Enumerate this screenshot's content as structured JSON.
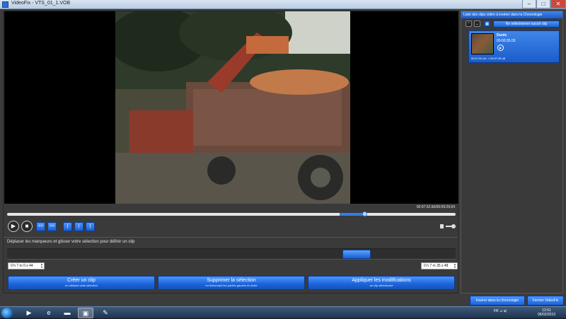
{
  "window": {
    "title": "VideoFix - VTS_01_1.VOB",
    "min": "–",
    "max": "□",
    "close": "✕"
  },
  "player": {
    "timecode": "00:07:32.66/00:09:29.64",
    "play": "▶",
    "stop": "■",
    "rewind": "<<",
    "forward": ">>",
    "mark_in": "[",
    "mark_cut": "|",
    "mark_out": "]",
    "seek_selection_start": 0.742,
    "seek_selection_end": 0.801,
    "seek_position": 0.797
  },
  "selection": {
    "instruction": "Déplacer les marqueurs et glisser votre sélection pour définir un clip",
    "start_time": "0 h  7 m  0 s 44",
    "end_time": "0 h  7 m 35 s 48",
    "spin_arrows": "▲\n▼"
  },
  "actions": [
    {
      "label": "Créer un clip",
      "sub": "en utilisant cette sélection"
    },
    {
      "label": "Supprimer la sélection",
      "sub": "en fusionnant les parties gauche et droite"
    },
    {
      "label": "Appliquer les modifications",
      "sub": "au clip sélectionné"
    }
  ],
  "clips_panel": {
    "header": "Liste des clips vidéo à insérer dans la Chronologie",
    "up": "⌃",
    "down": "⌄",
    "grid": "▦",
    "deselect": "Ne sélectionner aucun clip",
    "clip": {
      "label": "Durée",
      "duration": "00:00:35.03",
      "play": "▶",
      "range": "00:07:00.44 -> 00:07:35.48"
    }
  },
  "footer": {
    "insert": "Insérer dans la chronologie",
    "close": "Fermer VideoFix"
  },
  "taskbar": {
    "media": "▶",
    "browser": "e",
    "folder": "▬",
    "app": "▣",
    "paint": "✎",
    "tray": "FR  ⊿  ◂)",
    "time": "12:51",
    "date": "06/02/2013"
  },
  "colors": {
    "accent": "#1d63d8",
    "background": "#3a3a3a",
    "video_bg": "#000000"
  }
}
